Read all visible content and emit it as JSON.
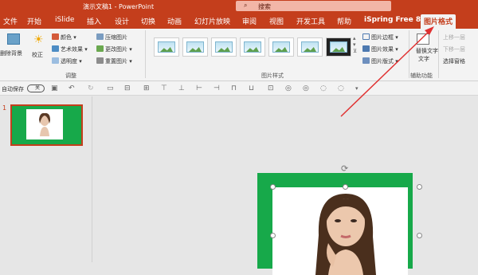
{
  "title": {
    "doc": "演示文稿1 - PowerPoint",
    "search": "搜索"
  },
  "tabs": [
    "文件",
    "开始",
    "iSlide",
    "插入",
    "设计",
    "切换",
    "动画",
    "幻灯片放映",
    "审阅",
    "视图",
    "开发工具",
    "帮助",
    "iSpring Free 8",
    "图片格式"
  ],
  "ribbon": {
    "remove_bg": "删除背景",
    "correct": "校正",
    "color": "颜色",
    "art": "艺术效果",
    "transparency": "透明度",
    "compress": "压缩图片",
    "change": "更改图片",
    "reset": "重置图片",
    "adjust_group": "调整",
    "styles_group": "图片样式",
    "border": "图片边框",
    "effect": "图片效果",
    "layout": "图片版式",
    "alt_text": "替换文字",
    "alt_text2": "文字",
    "access_group": "辅助功能",
    "bring_fwd": "上移一层",
    "send_back": "下移一层",
    "select_pane": "选择窗格"
  },
  "qat": {
    "autosave": "自动保存",
    "toggle": "关"
  },
  "slides": {
    "num": "1"
  },
  "icons": [
    "search-icon",
    "remove-bg-icon",
    "correct-icon",
    "color-icon",
    "art-icon",
    "transparency-icon",
    "compress-icon",
    "change-icon",
    "reset-icon",
    "border-icon",
    "effect-icon",
    "layout-icon",
    "alt-text-icon",
    "undo-icon",
    "redo-icon",
    "rotate-icon"
  ],
  "colors": {
    "accent": "#c43e1c",
    "slide_bg": "#17a94a"
  }
}
